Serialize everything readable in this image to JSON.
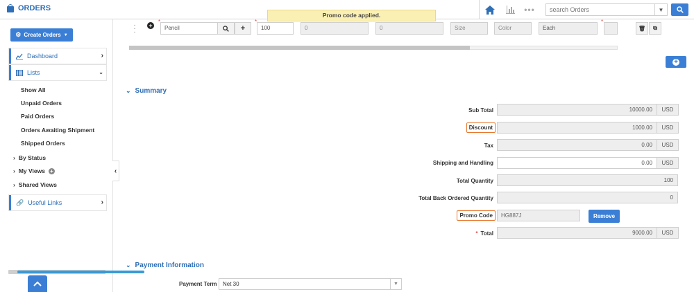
{
  "header": {
    "app_title": "ORDERS",
    "search_placeholder": "search Orders"
  },
  "toast": "Promo code applied.",
  "sidebar": {
    "create_button": "Create Orders",
    "nav": [
      {
        "label": "Dashboard"
      },
      {
        "label": "Lists"
      }
    ],
    "list_items": [
      "Show All",
      "Unpaid Orders",
      "Paid Orders",
      "Orders Awaiting Shipment",
      "Shipped Orders"
    ],
    "groups": [
      "By Status",
      "My Views",
      "Shared Views"
    ],
    "useful_links": "Useful Links"
  },
  "line_item": {
    "product": "Pencil",
    "quantity": "100",
    "price": "0",
    "amount": "0",
    "size_placeholder": "Size",
    "color_placeholder": "Color",
    "unit": "Each"
  },
  "summary": {
    "title": "Summary",
    "sub_total": {
      "label": "Sub Total",
      "value": "10000.00",
      "unit": "USD"
    },
    "discount": {
      "label": "Discount",
      "value": "1000.00",
      "unit": "USD"
    },
    "tax": {
      "label": "Tax",
      "value": "0.00",
      "unit": "USD"
    },
    "shipping": {
      "label": "Shipping and Handling",
      "value": "0.00",
      "unit": "USD"
    },
    "total_quantity": {
      "label": "Total Quantity",
      "value": "100"
    },
    "total_back_ordered": {
      "label": "Total Back Ordered Quantity",
      "value": "0"
    },
    "promo_code": {
      "label": "Promo Code",
      "value": "HG887J",
      "remove_label": "Remove"
    },
    "total": {
      "label": "Total",
      "value": "9000.00",
      "unit": "USD"
    }
  },
  "payment": {
    "title": "Payment Information",
    "term_label": "Payment Term",
    "term_value": "Net 30"
  },
  "colors": {
    "accent": "#3a7fd5",
    "highlight": "#e8762c",
    "toast_bg": "#fbf0b4"
  }
}
